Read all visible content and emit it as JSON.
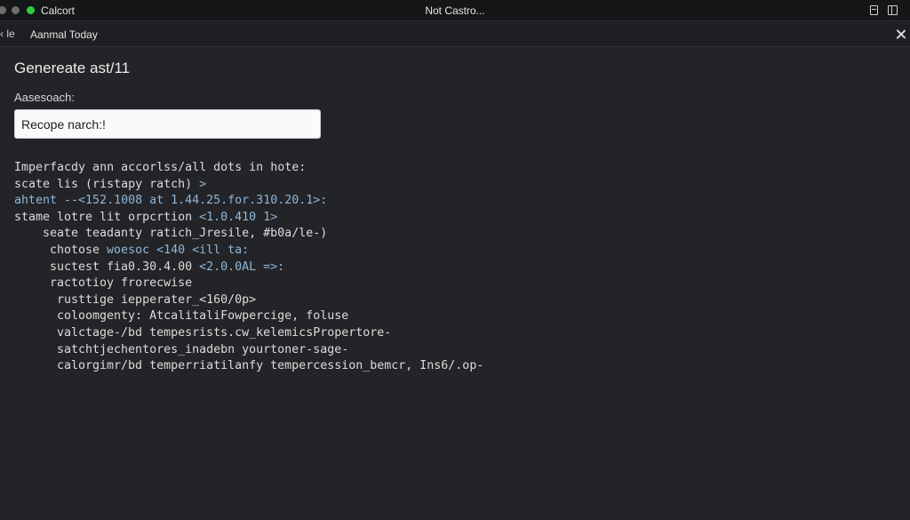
{
  "window": {
    "app_name": "Calcort",
    "title": "Not Castro..."
  },
  "tab": {
    "left_glyph": "‹ le",
    "title": "Aanmal Today"
  },
  "main": {
    "heading": "Genereate ast/11",
    "field_label": "Aasesoach:",
    "input_value": "Recope narch:!"
  },
  "code_lines": [
    {
      "indent": 2,
      "segments": [
        {
          "t": "Imperfacdy ann accorlss/all dots in hote:",
          "c": "w"
        }
      ]
    },
    {
      "indent": 2,
      "segments": [
        {
          "t": "scate lis (ristapy ratch) ",
          "c": "w"
        },
        {
          "t": ">",
          "c": "b"
        }
      ]
    },
    {
      "indent": 2,
      "segments": [
        {
          "t": "ahtent --<152.1008 at 1.44.25.for.310.20.1>:",
          "c": "b"
        }
      ]
    },
    {
      "indent": 2,
      "segments": [
        {
          "t": "stame lotre lit orpcrtion ",
          "c": "w"
        },
        {
          "t": "<1.0.410 1>",
          "c": "b"
        }
      ]
    },
    {
      "indent": 6,
      "segments": [
        {
          "t": "seate teadanty ratich_Jresile, #b0a/le-)",
          "c": "w"
        }
      ]
    },
    {
      "indent": 7,
      "segments": [
        {
          "t": "chotose ",
          "c": "w"
        },
        {
          "t": "woesoc <140 <ill ta:",
          "c": "b"
        }
      ]
    },
    {
      "indent": 7,
      "segments": [
        {
          "t": "suctest fia0.30.4.00 ",
          "c": "w"
        },
        {
          "t": "<2.0.0AL =>:",
          "c": "b"
        }
      ]
    },
    {
      "indent": 7,
      "segments": [
        {
          "t": "ractotioy frorecwise",
          "c": "w"
        }
      ]
    },
    {
      "indent": 8,
      "segments": [
        {
          "t": "rusttige iepperater_<160/0p>",
          "c": "w"
        }
      ]
    },
    {
      "indent": 8,
      "segments": [
        {
          "t": "coloomgenty: AtcalitaliFowpercige, foluse",
          "c": "w"
        }
      ]
    },
    {
      "indent": 8,
      "segments": [
        {
          "t": "valctage-/bd tempesrists.cw_kelemicsPropertore-",
          "c": "w"
        }
      ]
    },
    {
      "indent": 8,
      "segments": [
        {
          "t": "satchtjechentores_inadebn yourtoner-sage-",
          "c": "w"
        }
      ]
    },
    {
      "indent": 8,
      "segments": [
        {
          "t": "calorgimr/bd temperriatilanfy tempercession_bemcr, Ins6/.op-",
          "c": "w"
        }
      ]
    }
  ],
  "colors": {
    "background": "#232427",
    "titlebar": "#151618",
    "code_text": "#dcdcdc",
    "code_accent": "#8fb6d8",
    "status_dot": "#2ecc40"
  },
  "icons": [
    "window-dot-icon",
    "document-icon",
    "sidebar-panel-icon",
    "close-icon"
  ]
}
